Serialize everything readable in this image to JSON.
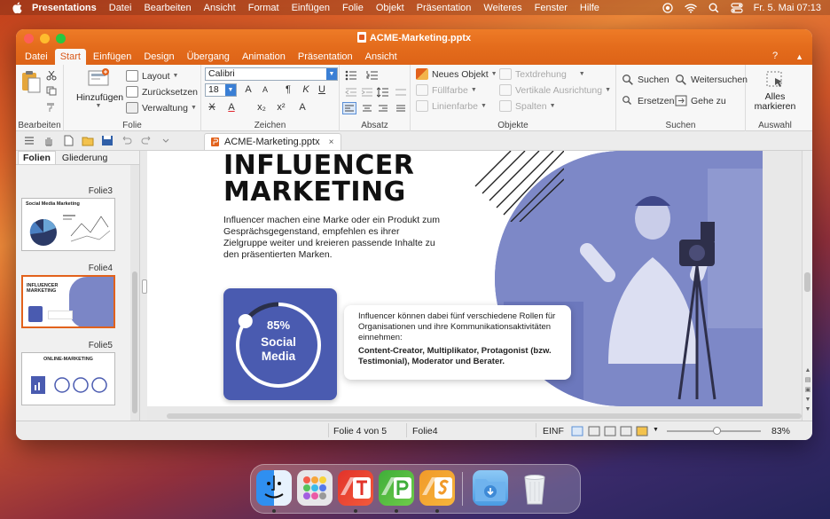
{
  "menubar": {
    "app": "Presentations",
    "items": [
      "Datei",
      "Bearbeiten",
      "Ansicht",
      "Format",
      "Einfügen",
      "Folie",
      "Objekt",
      "Präsentation",
      "Weiteres",
      "Fenster",
      "Hilfe"
    ],
    "clock": "Fr. 5. Mai  07:13"
  },
  "window": {
    "title": "ACME-Marketing.pptx",
    "tabs": [
      "Datei",
      "Start",
      "Einfügen",
      "Design",
      "Übergang",
      "Animation",
      "Präsentation",
      "Ansicht"
    ],
    "active_tab": "Start",
    "help": "?"
  },
  "ribbon": {
    "bearbeiten": {
      "label": "Bearbeiten"
    },
    "folie": {
      "label": "Folie",
      "add": "Hinzufügen",
      "layout": "Layout",
      "reset": "Zurücksetzen",
      "manage": "Verwaltung"
    },
    "zeichen": {
      "label": "Zeichen",
      "font": "Calibri",
      "size": "18",
      "btn_grow": "A",
      "btn_shrink": "A",
      "btn_clear": "¶",
      "btn_italic": "K",
      "btn_under": "U",
      "btn_strike": "X",
      "btn_color": "A",
      "btn_sub": "x₂",
      "btn_sup": "x²",
      "btn_case": "A"
    },
    "absatz": {
      "label": "Absatz"
    },
    "objekte": {
      "label": "Objekte",
      "new_object": "Neues Objekt",
      "fill": "Füllfarbe",
      "line": "Linienfarbe",
      "text_rot": "Textdrehung",
      "vert_align": "Vertikale Ausrichtung",
      "columns": "Spalten"
    },
    "suchen": {
      "label": "Suchen",
      "search": "Suchen",
      "search_next": "Weitersuchen",
      "replace": "Ersetzen",
      "goto": "Gehe zu"
    },
    "auswahl": {
      "label": "Auswahl",
      "select_all": "Alles markieren"
    }
  },
  "doc_tab": {
    "name": "ACME-Marketing.pptx",
    "close": "×"
  },
  "sidepanel": {
    "tabs": [
      "Folien",
      "Gliederung"
    ],
    "slides": [
      {
        "label": "Folie3",
        "title": "Social Media Marketing"
      },
      {
        "label": "Folie4",
        "title": "INFLUENCER MARKETING"
      },
      {
        "label": "Folie5",
        "title": "ONLINE-MARKETING"
      }
    ]
  },
  "slide": {
    "title_line1": "INFLUENCER",
    "title_line2": "MARKETING",
    "intro": "Influencer machen eine Marke oder ein Produkt zum Gesprächsgegenstand, empfehlen es ihrer Zielgruppe weiter und kreieren passende Inhalte zu den präsentierten Marken.",
    "stat_value": "85%",
    "stat_line1": "Social",
    "stat_line2": "Media",
    "stat_fraction": 0.85,
    "info_text": "Influencer können dabei fünf verschiedene Rollen für Organisationen und ihre Kommunikationsaktivitäten einnehmen:",
    "info_bold": "Content-Creator, Multiplikator, Protagonist (bzw. Testimonial), Moderator und Berater.",
    "colors": {
      "accent": "#4a5bb0",
      "overlay": "#7b86c6"
    }
  },
  "statusbar": {
    "slide_pos": "Folie 4 von 5",
    "slide_name": "Folie4",
    "mode": "EINF",
    "zoom": "83%"
  },
  "colors": {
    "titlebar": "#e46c1c",
    "active_tab_text": "#d9591a"
  }
}
